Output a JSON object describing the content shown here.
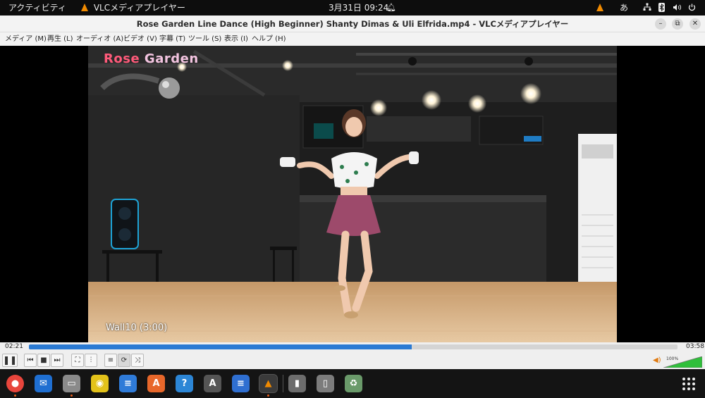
{
  "topbar": {
    "activities": "アクティビティ",
    "app_name": "VLCメディアプレイヤー",
    "datetime": "3月31日  09:24",
    "ime": "あ"
  },
  "window": {
    "title": "Rose Garden Line Dance (High Beginner) Shanty Dimas & Uli Elfrida.mp4 - VLCメディアプレイヤー"
  },
  "menu": {
    "items": [
      {
        "label": "メディア (M)"
      },
      {
        "label": "再生 (L)"
      },
      {
        "label": "オーディオ (A)"
      },
      {
        "label": "ビデオ (V)"
      },
      {
        "label": "字幕 (T)"
      },
      {
        "label": "ツール (S)"
      },
      {
        "label": "表示 (I)"
      },
      {
        "label": "ヘルプ (H)"
      }
    ]
  },
  "video": {
    "overlay_title_a": "Rose",
    "overlay_title_b": " Garden",
    "caption": "Wall10 (3:00)"
  },
  "player": {
    "elapsed": "02:21",
    "total": "03:58",
    "progress": 0.59,
    "volume_percent": "100%",
    "accent": "#2a7ad3"
  },
  "dock": {
    "apps": [
      {
        "name": "chrome-icon",
        "color": "#e8453c",
        "glyph": "●",
        "running": true
      },
      {
        "name": "thunderbird-icon",
        "color": "#1f6fd1",
        "glyph": "✉",
        "running": false
      },
      {
        "name": "files-icon",
        "color": "#8a8a8a",
        "glyph": "▭",
        "running": true
      },
      {
        "name": "rhythmbox-icon",
        "color": "#e3c21a",
        "glyph": "◉",
        "running": false
      },
      {
        "name": "libreoffice-writer-icon",
        "color": "#2f7bd8",
        "glyph": "≡",
        "running": false
      },
      {
        "name": "software-center-icon",
        "color": "#e8672a",
        "glyph": "A",
        "running": false
      },
      {
        "name": "help-icon",
        "color": "#2c86d6",
        "glyph": "?",
        "running": false
      },
      {
        "name": "app-center-icon",
        "color": "#555555",
        "glyph": "A",
        "running": false
      },
      {
        "name": "text-editor-icon",
        "color": "#2f6fd1",
        "glyph": "≡",
        "running": false
      },
      {
        "name": "vlc-icon",
        "color": "#3a3a3a",
        "glyph": "▲",
        "running": true
      },
      {
        "name": "removable-drive-icon",
        "color": "#6d6d6d",
        "glyph": "▮",
        "running": false
      },
      {
        "name": "usb-drive-icon",
        "color": "#7c7c7c",
        "glyph": "▯",
        "running": false
      },
      {
        "name": "trash-icon",
        "color": "#6a9a6a",
        "glyph": "♻",
        "running": false
      }
    ]
  }
}
